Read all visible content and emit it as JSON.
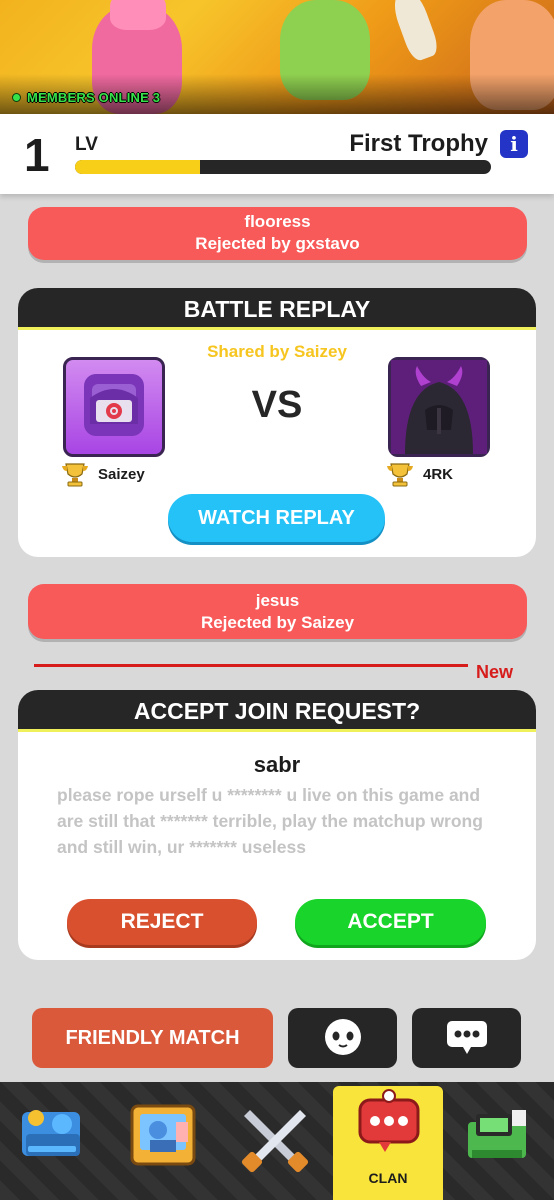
{
  "banner": {
    "members_online": "MEMBERS ONLINE 3"
  },
  "level": {
    "number": "1",
    "label": "LV",
    "goal": "First Trophy",
    "info": "i",
    "progress_percent": 30
  },
  "feed": {
    "rejected_1": {
      "name": "flooress",
      "status": "Rejected by gxstavo"
    },
    "battle_replay": {
      "title": "BATTLE REPLAY",
      "shared_by": "Shared by Saizey",
      "vs": "VS",
      "player_left": "Saizey",
      "player_right": "4RK",
      "watch_label": "WATCH REPLAY"
    },
    "rejected_2": {
      "name": "jesus",
      "status": "Rejected by Saizey"
    },
    "new_label": "New",
    "join_request": {
      "title": "ACCEPT JOIN REQUEST?",
      "name": "sabr",
      "message": "please rope urself u ******** u live on this game and are still that ******* terrible, play the matchup wrong and still win, ur ******* useless",
      "reject_label": "REJECT",
      "accept_label": "ACCEPT"
    }
  },
  "actions": {
    "friendly_match": "FRIENDLY MATCH",
    "emote_icon": "emote-face-icon",
    "chat_icon": "chat-bubble-icon"
  },
  "nav": {
    "items": [
      {
        "icon": "shop-icon"
      },
      {
        "icon": "cards-icon"
      },
      {
        "icon": "battle-swords-icon"
      },
      {
        "icon": "clan-icon",
        "label": "CLAN",
        "active": true
      },
      {
        "icon": "events-icon"
      }
    ]
  },
  "colors": {
    "accent_red": "#f85a5a",
    "accent_blue": "#25c2f7",
    "accept_green": "#19d42b",
    "reject_orange": "#d9502f",
    "nav_active": "#f8e43a"
  }
}
